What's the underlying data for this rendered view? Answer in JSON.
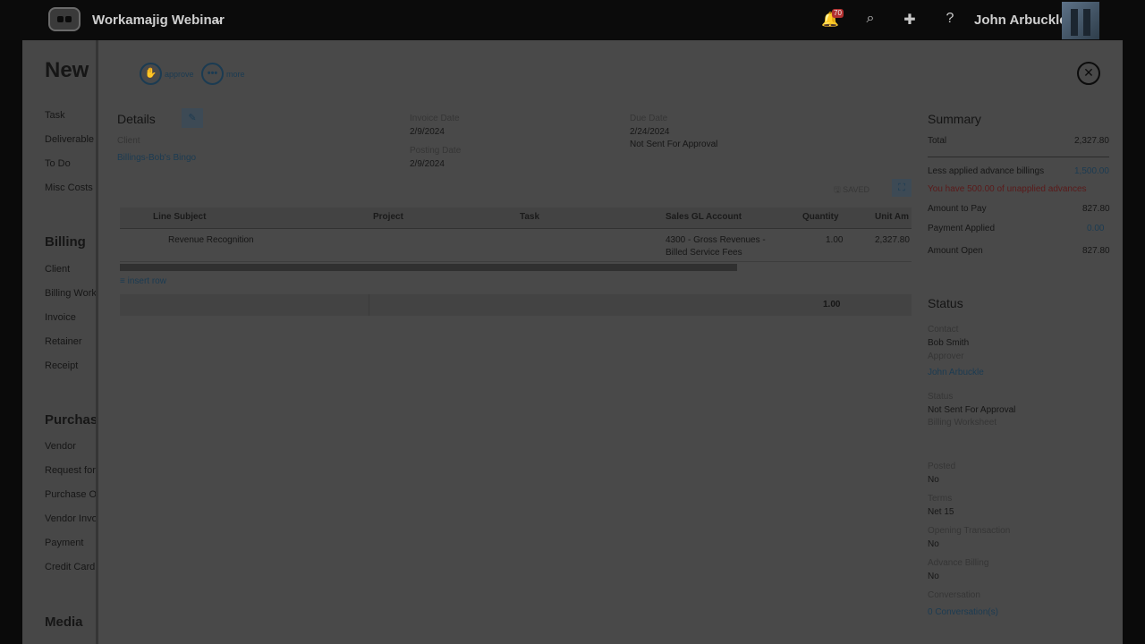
{
  "topbar": {
    "workspace": "Workamajig Webinar",
    "notification_count": "70",
    "user_name": "John Arbuckle"
  },
  "left_panel": {
    "title": "New",
    "items_top": [
      "Task",
      "Deliverable",
      "To Do",
      "Misc Costs"
    ],
    "billing_heading": "Billing",
    "billing_items": [
      "Client",
      "Billing Work",
      "Invoice",
      "Retainer",
      "Receipt"
    ],
    "purchasing_heading": "Purchas",
    "purchasing_items": [
      "Vendor",
      "Request for",
      "Purchase Or",
      "Vendor Invo",
      "Payment",
      "Credit Card"
    ],
    "media_heading": "Media"
  },
  "toolbar": {
    "approve_label": "approve",
    "more_label": "more"
  },
  "details": {
    "heading": "Details",
    "client_label": "Client",
    "client_value": "Billings-Bob's Bingo",
    "invoice_date_label": "Invoice Date",
    "invoice_date": "2/9/2024",
    "posting_date_label": "Posting Date",
    "posting_date": "2/9/2024",
    "due_date_label": "Due Date",
    "due_date": "2/24/2024",
    "approval_status": "Not Sent For Approval"
  },
  "grid": {
    "saved_label": "SAVED",
    "columns": [
      "Line Subject",
      "Project",
      "Task",
      "Sales GL Account",
      "Quantity",
      "Unit Am"
    ],
    "rows": [
      {
        "line_subject": "Revenue Recognition",
        "project": "",
        "task": "",
        "gl_line1": "4300 - Gross Revenues -",
        "gl_line2": "Billed Service Fees",
        "quantity": "1.00",
        "unit_amount": "2,327.80"
      }
    ],
    "insert_row_label": "insert row",
    "total_quantity": "1.00"
  },
  "summary": {
    "heading": "Summary",
    "total_label": "Total",
    "total_value": "2,327.80",
    "advance_label": "Less applied advance billings",
    "advance_value": "1,500.00",
    "unapplied_warning": "You have 500.00 of unapplied advances",
    "amount_to_pay_label": "Amount to Pay",
    "amount_to_pay_value": "827.80",
    "payment_applied_label": "Payment Applied",
    "payment_applied_value": "0.00",
    "amount_open_label": "Amount Open",
    "amount_open_value": "827.80"
  },
  "status": {
    "heading": "Status",
    "contact_label": "Contact",
    "contact_value": "Bob Smith",
    "approver_label": "Approver",
    "approver_value": "John Arbuckle",
    "status_label": "Status",
    "status_value": "Not Sent For Approval",
    "status_sub": "Billing Worksheet",
    "posted_label": "Posted",
    "posted_value": "No",
    "terms_label": "Terms",
    "terms_value": "Net 15",
    "opening_label": "Opening Transaction",
    "opening_value": "No",
    "advance_billing_label": "Advance Billing",
    "advance_billing_value": "No",
    "conversation_label": "Conversation",
    "conversation_value": "0 Conversation(s)"
  },
  "colors": {
    "link": "#1b3b52",
    "warning": "#5a1a1a",
    "overlay": "#494949"
  }
}
